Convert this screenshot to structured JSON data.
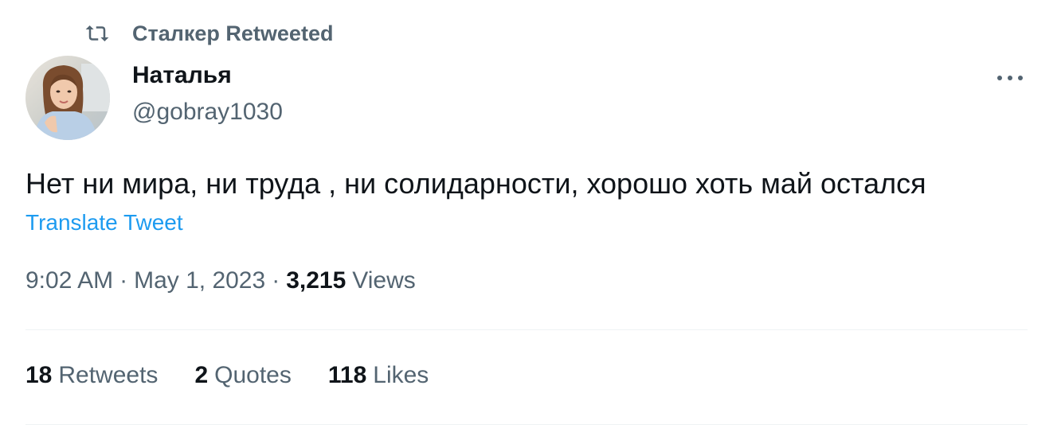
{
  "retweet_header": {
    "text": "Сталкер Retweeted",
    "icon": "retweet-icon"
  },
  "author": {
    "name": "Наталья",
    "handle": "@gobray1030",
    "avatar": "avatar-photo"
  },
  "more_icon": "more-horizontal-icon",
  "tweet": {
    "text": "Нет ни мира, ни труда , ни солидарности, хорошо хоть май остался",
    "translate_label": "Translate Tweet"
  },
  "meta": {
    "time": "9:02 AM",
    "separator": "·",
    "date": "May 1, 2023",
    "views_count": "3,215",
    "views_label": "Views"
  },
  "stats": {
    "retweets_count": "18",
    "retweets_label": "Retweets",
    "quotes_count": "2",
    "quotes_label": "Quotes",
    "likes_count": "118",
    "likes_label": "Likes"
  },
  "colors": {
    "primary_text": "#0f1419",
    "secondary_text": "#536471",
    "link": "#1d9bf0",
    "divider": "#eff3f4"
  }
}
